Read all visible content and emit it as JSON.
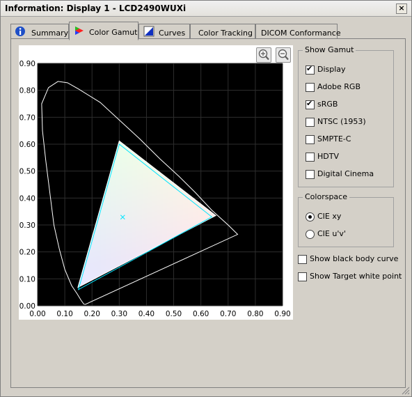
{
  "window": {
    "title": "Information: Display 1 - LCD2490WUXi",
    "close_glyph": "×"
  },
  "tabs": [
    {
      "label": "Summary",
      "icon": "info-icon",
      "active": false
    },
    {
      "label": "Color Gamut",
      "icon": "color-gamut-icon",
      "active": true
    },
    {
      "label": "Curves",
      "icon": "curves-icon",
      "active": false
    },
    {
      "label": "Color Tracking",
      "active": false
    },
    {
      "label": "DICOM Conformance",
      "active": false
    }
  ],
  "zoom": {
    "in_icon": "zoom-in-icon",
    "out_icon": "zoom-out-icon"
  },
  "show_gamut": {
    "legend": "Show Gamut",
    "items": [
      {
        "label": "Display",
        "checked": true
      },
      {
        "label": "Adobe RGB",
        "checked": false
      },
      {
        "label": "sRGB",
        "checked": true
      },
      {
        "label": "NTSC (1953)",
        "checked": false
      },
      {
        "label": "SMPTE-C",
        "checked": false
      },
      {
        "label": "HDTV",
        "checked": false
      },
      {
        "label": "Digital Cinema",
        "checked": false
      }
    ]
  },
  "colorspace": {
    "legend": "Colorspace",
    "options": [
      {
        "label": "CIE xy",
        "selected": true
      },
      {
        "label": "CIE u'v'",
        "selected": false
      }
    ]
  },
  "options": [
    {
      "label": "Show black body curve",
      "checked": false
    },
    {
      "label": "Show Target white point",
      "checked": false
    }
  ],
  "colors": {
    "plot_bg": "#000000",
    "grid": "#2e2e2e",
    "spectral": "#ffffff",
    "srgb_outline": "#00e5ff",
    "white_marker": "#00e5ff"
  },
  "chart_data": {
    "type": "scatter",
    "xlim": [
      0,
      0.9
    ],
    "ylim": [
      0,
      0.9
    ],
    "x_ticks": [
      "0.00",
      "0.10",
      "0.20",
      "0.30",
      "0.40",
      "0.50",
      "0.60",
      "0.70",
      "0.80",
      "0.90"
    ],
    "y_ticks": [
      "0.00",
      "0.10",
      "0.20",
      "0.30",
      "0.40",
      "0.50",
      "0.60",
      "0.70",
      "0.80",
      "0.90"
    ],
    "grid": true,
    "spectral_locus": [
      [
        0.175,
        0.005
      ],
      [
        0.17,
        0.006
      ],
      [
        0.16,
        0.02
      ],
      [
        0.145,
        0.045
      ],
      [
        0.125,
        0.075
      ],
      [
        0.1,
        0.135
      ],
      [
        0.08,
        0.21
      ],
      [
        0.06,
        0.3
      ],
      [
        0.045,
        0.42
      ],
      [
        0.03,
        0.54
      ],
      [
        0.018,
        0.65
      ],
      [
        0.015,
        0.75
      ],
      [
        0.04,
        0.81
      ],
      [
        0.075,
        0.833
      ],
      [
        0.11,
        0.828
      ],
      [
        0.15,
        0.805
      ],
      [
        0.23,
        0.755
      ],
      [
        0.3,
        0.69
      ],
      [
        0.375,
        0.62
      ],
      [
        0.45,
        0.545
      ],
      [
        0.52,
        0.48
      ],
      [
        0.58,
        0.42
      ],
      [
        0.64,
        0.355
      ],
      [
        0.7,
        0.3
      ],
      [
        0.735,
        0.265
      ]
    ],
    "gamut_display": {
      "red": [
        0.655,
        0.335
      ],
      "green": [
        0.3,
        0.612
      ],
      "blue": [
        0.148,
        0.068
      ]
    },
    "gamut_srgb": {
      "red": [
        0.64,
        0.33
      ],
      "green": [
        0.3,
        0.6
      ],
      "blue": [
        0.15,
        0.06
      ]
    },
    "white_point": [
      0.3127,
      0.329
    ]
  }
}
